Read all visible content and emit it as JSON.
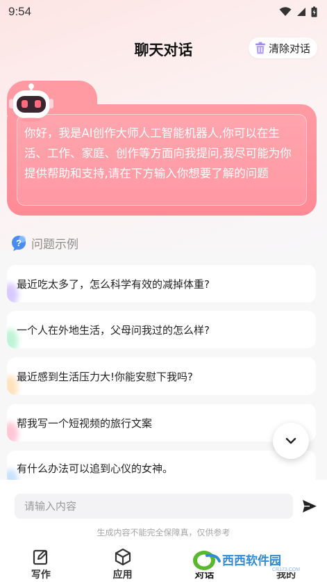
{
  "status_bar": {
    "time": "9:54"
  },
  "header": {
    "title": "聊天对话",
    "clear_label": "清除对话"
  },
  "intro": {
    "text": "你好，我是AI创作大师人工智能机器人,你可以在生活、工作、家庭、创作等方面向我提问,我尽可能为你提供帮助和支持,请在下方输入你想要了解的问题"
  },
  "examples": {
    "title": "问题示例",
    "items": [
      {
        "text": "最近吃太多了，怎么科学有效的减掉体重?",
        "accent": "#c9b8ff"
      },
      {
        "text": "一个人在外地生活，父母问我过的怎么样?",
        "accent": "#a8f0c8"
      },
      {
        "text": "最近感到生活压力大!你能安慰下我吗?",
        "accent": "#ffd9a8"
      },
      {
        "text": "帮我写一个短视频的旅行文案",
        "accent": "#ffb3c8"
      },
      {
        "text": "有什么办法可以追到心仪的女神。",
        "accent": "#b8d8ff"
      }
    ]
  },
  "input": {
    "placeholder": "请输入内容",
    "value": ""
  },
  "disclaimer": "生成内容不能完全保障真，仅供参考",
  "tabs": [
    {
      "label": "写作",
      "icon": "edit-icon"
    },
    {
      "label": "应用",
      "icon": "cube-icon"
    },
    {
      "label": "对话",
      "icon": "chat-icon",
      "active": true
    },
    {
      "label": "我的",
      "icon": "user-icon"
    }
  ],
  "watermark": {
    "text": "西西软件园",
    "sub": "CR173.COM"
  },
  "colors": {
    "accent_pink": "#ff8a96",
    "page_bg": "#f7f7f8"
  }
}
